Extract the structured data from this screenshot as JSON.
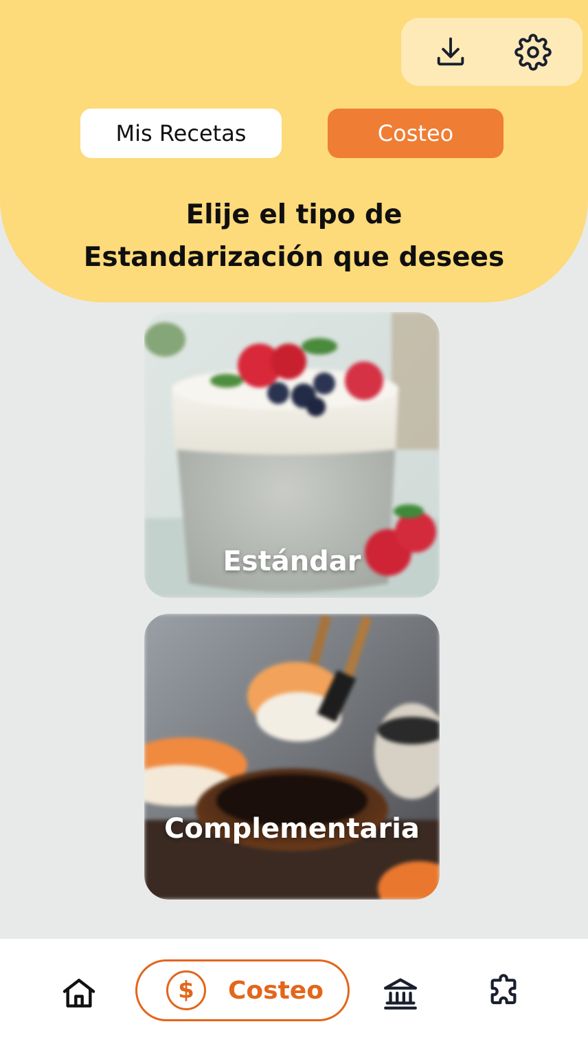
{
  "header": {
    "heading_line1": "Elije el tipo de",
    "heading_line2": "Estandarización que desees",
    "color": "#fdda7a"
  },
  "top_actions": {
    "download_icon": "download-icon",
    "settings_icon": "gear-icon"
  },
  "tabs": [
    {
      "label": "Mis Recetas",
      "active": false
    },
    {
      "label": "Costeo",
      "active": true,
      "color": "#ef7d34"
    }
  ],
  "cards": [
    {
      "label": "Estándar",
      "image": "chia-pudding-with-berries"
    },
    {
      "label": "Complementaria",
      "image": "sushi-with-chopsticks"
    }
  ],
  "bottom_nav": {
    "items": [
      {
        "icon": "home-icon",
        "label": ""
      },
      {
        "icon": "dollar-coin-icon",
        "label": "Costeo",
        "symbol": "$",
        "active": true
      },
      {
        "icon": "bank-icon",
        "label": ""
      },
      {
        "icon": "puzzle-icon",
        "label": ""
      }
    ],
    "accent": "#e2661b"
  }
}
